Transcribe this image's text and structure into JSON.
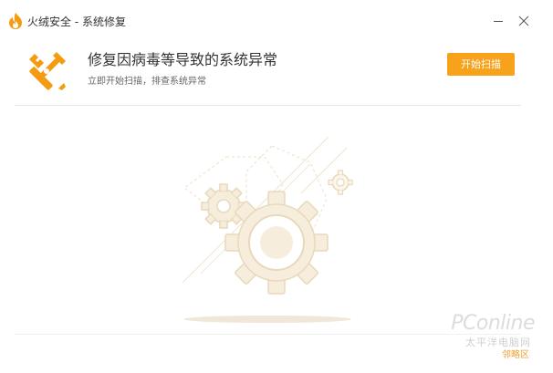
{
  "window": {
    "title": "火绒安全 - 系统修复",
    "logo_icon": "huorong-flame-icon",
    "minimize_icon": "minimize-icon",
    "close_icon": "close-icon"
  },
  "header": {
    "icon": "wrench-screwdriver-icon",
    "headline": "修复因病毒等导致的系统异常",
    "subline": "立即开始扫描，排查系统异常",
    "scan_button_label": "开始扫描"
  },
  "illustration": {
    "icon": "gears-illustration"
  },
  "watermark": {
    "brand": "PConline",
    "sub": "太平洋电脑网",
    "area": "邻略区"
  },
  "colors": {
    "accent": "#f7a21b",
    "icon_orange": "#f39c12",
    "gear_fill": "#f6eddc",
    "gear_stroke": "#e8d9bc"
  }
}
